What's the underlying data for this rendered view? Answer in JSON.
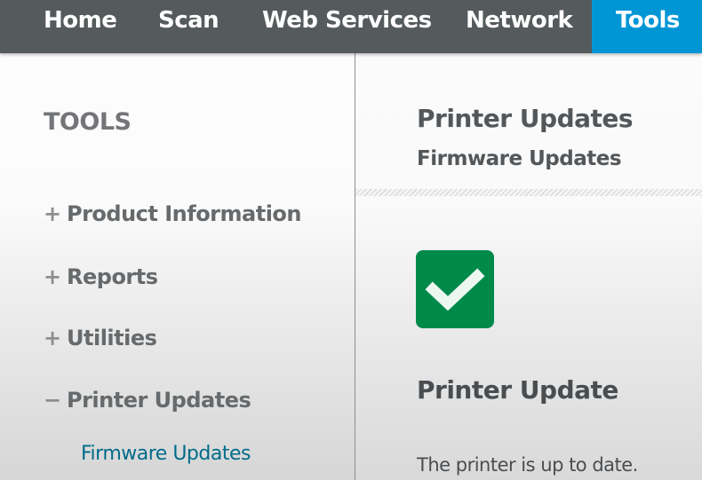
{
  "nav": {
    "items": [
      {
        "label": "Home",
        "active": false
      },
      {
        "label": "Scan",
        "active": false
      },
      {
        "label": "Web Services",
        "active": false
      },
      {
        "label": "Network",
        "active": false
      },
      {
        "label": "Tools",
        "active": true
      }
    ],
    "active_color": "#0096d6",
    "bar_color": "#555a5c"
  },
  "sidebar": {
    "title": "TOOLS",
    "items": [
      {
        "sign": "+",
        "label": "Product Information",
        "expanded": false
      },
      {
        "sign": "+",
        "label": "Reports",
        "expanded": false
      },
      {
        "sign": "+",
        "label": "Utilities",
        "expanded": false
      },
      {
        "sign": "−",
        "label": "Printer Updates",
        "expanded": true
      }
    ],
    "sub_items": [
      {
        "label": "Firmware Updates",
        "selected": true
      }
    ]
  },
  "main": {
    "title": "Printer Updates",
    "subtitle": "Firmware Updates",
    "status_icon": "checkmark-icon",
    "status_color": "#008a4a",
    "section_title": "Printer Update",
    "status_text": "The printer is up to date."
  }
}
